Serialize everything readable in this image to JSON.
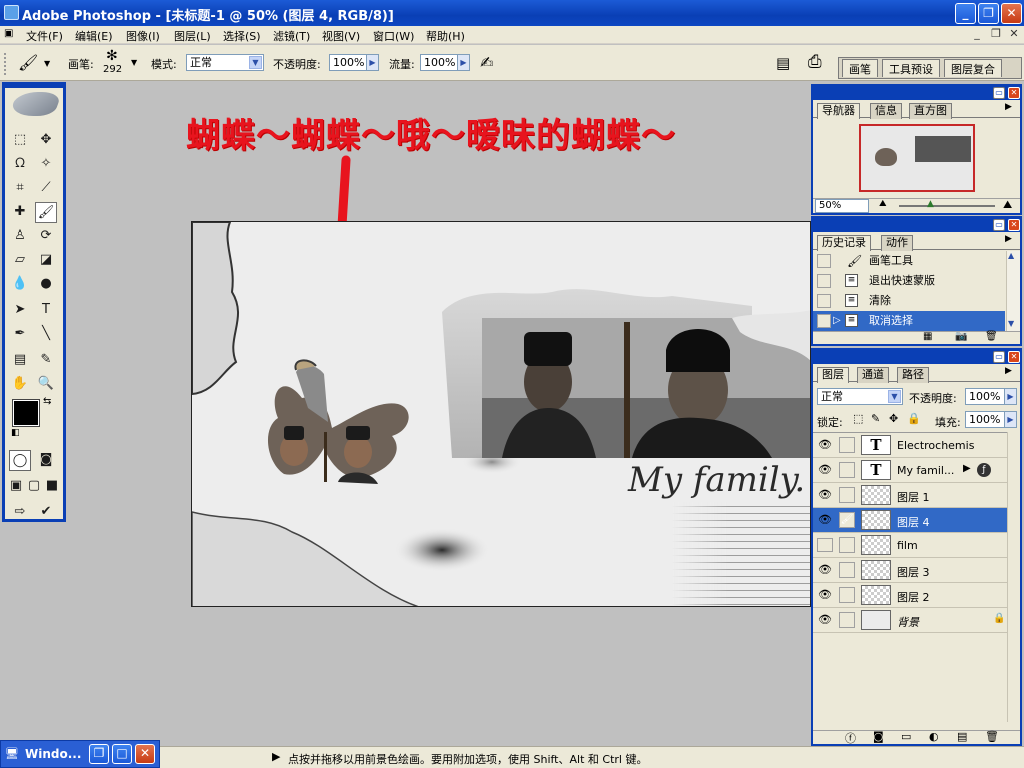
{
  "app": {
    "title": "Adobe Photoshop - [未标题-1 @ 50% (图层 4, RGB/8)]"
  },
  "menu": [
    "文件(F)",
    "编辑(E)",
    "图像(I)",
    "图层(L)",
    "选择(S)",
    "滤镜(T)",
    "视图(V)",
    "窗口(W)",
    "帮助(H)"
  ],
  "options": {
    "brush_label": "画笔:",
    "brush_size": "292",
    "mode_label": "模式:",
    "mode_value": "正常",
    "opacity_label": "不透明度:",
    "opacity_value": "100%",
    "flow_label": "流量:",
    "flow_value": "100%",
    "well_tabs": [
      "画笔",
      "工具预设",
      "图层复合"
    ]
  },
  "canvas": {
    "annotation": "蝴蝶～蝴蝶～哦～暧昧的蝴蝶～",
    "script_text": "My family."
  },
  "navigator": {
    "tabs": [
      "导航器",
      "信息",
      "直方图"
    ],
    "zoom": "50%"
  },
  "history": {
    "tabs": [
      "历史记录",
      "动作"
    ],
    "items": [
      "画笔工具",
      "退出快速蒙版",
      "清除",
      "取消选择"
    ],
    "active_index": 3
  },
  "layers": {
    "tabs": [
      "图层",
      "通道",
      "路径"
    ],
    "blend_mode": "正常",
    "opacity_label": "不透明度:",
    "opacity_value": "100%",
    "lock_label": "锁定:",
    "fill_label": "填充:",
    "fill_value": "100%",
    "items": [
      {
        "name": "Electrochemis...",
        "kind": "text",
        "visible": true
      },
      {
        "name": "My famil...",
        "kind": "text",
        "visible": true
      },
      {
        "name": "图层 1",
        "kind": "pixel",
        "visible": true
      },
      {
        "name": "图层 4",
        "kind": "pixel",
        "visible": true,
        "active": true
      },
      {
        "name": "film",
        "kind": "pixel",
        "visible": false
      },
      {
        "name": "图层 3",
        "kind": "pixel",
        "visible": true
      },
      {
        "name": "图层 2",
        "kind": "pixel",
        "visible": true
      },
      {
        "name": "背景",
        "kind": "background",
        "visible": true,
        "locked": true
      }
    ]
  },
  "status": {
    "text": "点按并拖移以用前景色绘画。要用附加选项，使用 Shift、Alt 和 Ctrl 键。"
  },
  "taskbar": {
    "label": "Windo..."
  },
  "colors": {
    "xp_blue": "#0a3fb5",
    "selection": "#3169c6",
    "annotation_red": "#e8141e",
    "panel_bg": "#ece9d8"
  }
}
